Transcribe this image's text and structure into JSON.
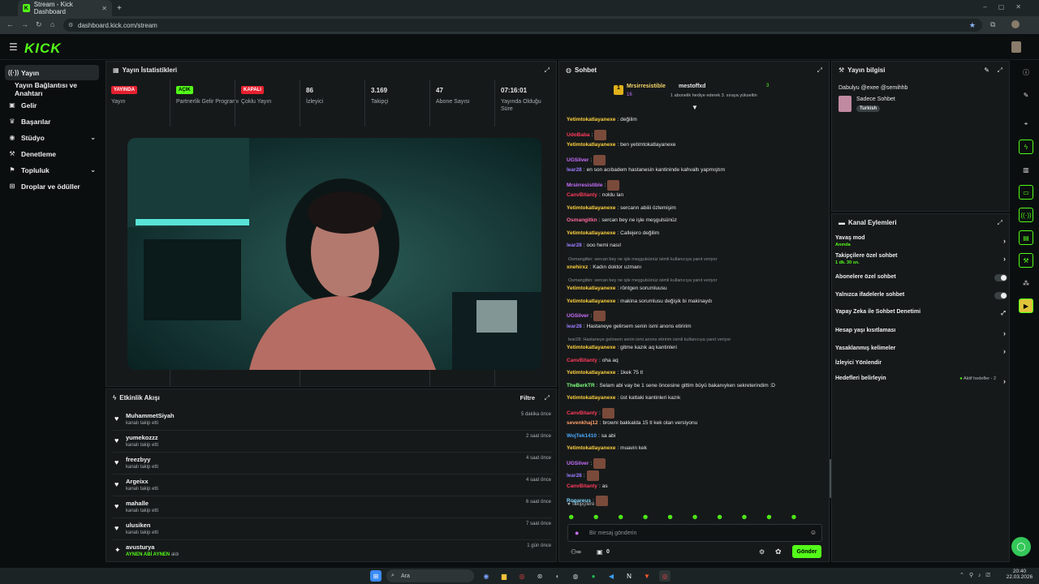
{
  "browser": {
    "tab_title": "Stream - Kick Dashboard",
    "url": "dashboard.kick.com/stream"
  },
  "app": {
    "logo": "KICK"
  },
  "sidebar": {
    "items": [
      {
        "label": "Yayın",
        "icon": "broadcast-icon"
      },
      {
        "label": "Yayın Bağlantısı ve Anahtarı",
        "icon": ""
      },
      {
        "label": "Gelir",
        "icon": "money-icon"
      },
      {
        "label": "Başarılar",
        "icon": "trophy-icon"
      },
      {
        "label": "Stüdyo",
        "icon": "palette-icon"
      },
      {
        "label": "Denetleme",
        "icon": "wrench-icon"
      },
      {
        "label": "Topluluk",
        "icon": "community-icon"
      },
      {
        "label": "Droplar ve ödüller",
        "icon": "gift-icon"
      }
    ]
  },
  "stats": {
    "title": "Yayın İstatistikleri",
    "items": [
      {
        "value": "YAYINDA",
        "label": "Yayın",
        "badge_color": "#e5202f"
      },
      {
        "value": "AÇIK",
        "label": "Partnerlik Gelir Programı",
        "badge_color": "#53fc18"
      },
      {
        "value": "KAPALI",
        "label": "Çoklu Yayın",
        "badge_color": "#e5202f"
      },
      {
        "value": "86",
        "label": "İzleyici"
      },
      {
        "value": "3.169",
        "label": "Takipçi"
      },
      {
        "value": "47",
        "label": "Abone Sayısı"
      },
      {
        "value": "07:16:01",
        "label": "Yayında Olduğu Süre"
      }
    ]
  },
  "activity": {
    "title": "Etkinlik Akışı",
    "filter": "Filtre",
    "items": [
      {
        "name": "MuhammetSiyah",
        "sub": "kanalı takip etti",
        "time": "5 dakika önce"
      },
      {
        "name": "yumekozzz",
        "sub": "kanalı takip etti",
        "time": "2 saat önce"
      },
      {
        "name": "freezbyy",
        "sub": "kanalı takip etti",
        "time": "4 saat önce"
      },
      {
        "name": "Argeixx",
        "sub": "kanalı takip etti",
        "time": "4 saat önce"
      },
      {
        "name": "mahalle",
        "sub": "kanalı takip etti",
        "time": "6 saat önce"
      },
      {
        "name": "ulusiken",
        "sub": "kanalı takip etti",
        "time": "7 saat önce"
      },
      {
        "name": "avusturya",
        "sub": "AYNEN ABİ AYNEN",
        "sub2": "aldı",
        "time": "1 gün önce"
      }
    ]
  },
  "chat": {
    "title": "Sohbet",
    "pinned": {
      "user1": "Mrsirresistible",
      "count1": "16",
      "user2": "mestoffxd",
      "count2": "3",
      "note": "1 abonelik hediye ederek 3. sıraya yükseltin"
    },
    "lines": [
      {
        "user": "Yetimtokatlayanexe",
        "color": "#ffd23f",
        "text": "değilim"
      },
      {
        "user": "UdoBaba",
        "color": "#ff3b5c",
        "text": "",
        "emote": true
      },
      {
        "user": "Yetimtokatlayanexe",
        "color": "#ffd23f",
        "text": "ben yetimtokatlayanexe"
      },
      {
        "user": "UGSilver",
        "color": "#c870ff",
        "text": "",
        "emote": true
      },
      {
        "user": "lear28",
        "color": "#9b7cff",
        "text": "en son acıbadem hastanesin kantininde kahvaltı yapmıştım"
      },
      {
        "user": "Mrsirresistible",
        "color": "#c870ff",
        "text": "",
        "emote": true
      },
      {
        "user": "CanvBitanty",
        "color": "#ff3b5c",
        "text": "noldu lan"
      },
      {
        "user": "Yetimtokatlayanexe",
        "color": "#ffd23f",
        "text": "sercann abiiii özlemişim"
      },
      {
        "user": "Osmangitkn",
        "color": "#ff6a9a",
        "text": "sercan bey ne işle meşgulsünüz"
      },
      {
        "user": "Yetimtokatlayanexe",
        "color": "#ffd23f",
        "text": "Callejero değilim"
      },
      {
        "user": "lear28",
        "color": "#9b7cff",
        "text": "ooo hemi nasıl"
      },
      {
        "reply": "Osmangitkn: sercan bey ne işle meşgulsünüz isimli kullanıcıya yanıt veriyor"
      },
      {
        "user": "xnehirxz",
        "color": "#ffd23f",
        "text": "Kadın doktor uzmanı"
      },
      {
        "reply": "Osmangitkn: sercan bey ne işle meşgulsünüz isimli kullanıcıya yanıt veriyor"
      },
      {
        "user": "Yetimtokatlayanexe",
        "color": "#ffd23f",
        "text": "röntgen sorumluusu"
      },
      {
        "user": "Yetimtokatlayanexe",
        "color": "#ffd23f",
        "text": "makina sorumlusu değişik bi makinaydı"
      },
      {
        "user": "UGSilver",
        "color": "#c870ff",
        "text": "",
        "emote": true
      },
      {
        "user": "lear28",
        "color": "#9b7cff",
        "text": "Hastaneye gelirsem senin ismi anons etiririm"
      },
      {
        "reply": "lear28: Hastaneye gelirsem senin ismi anons etiririm isimli kullanıcıya yanıt veriyor"
      },
      {
        "user": "Yetimtokatlayanexe",
        "color": "#ffd23f",
        "text": "gitme kazık aq kantinleri"
      },
      {
        "user": "CanvBitanty",
        "color": "#ff3b5c",
        "text": "oha aq"
      },
      {
        "user": "Yetimtokatlayanexe",
        "color": "#ffd23f",
        "text": "1kek 75 tl"
      },
      {
        "user": "TheBerkTR",
        "color": "#7dff7d",
        "text": "Selam abi vay be 1 sene öncesine gittim büyü bakanıyken sekreterindim :D"
      },
      {
        "user": "Yetimtokatlayanexe",
        "color": "#ffd23f",
        "text": "üst kattaki kantinleri kazık"
      },
      {
        "user": "CanvBitanty",
        "color": "#ff3b5c",
        "text": "",
        "emote": true
      },
      {
        "user": "sevenkhaj12",
        "color": "#ff9f6a",
        "text": "browni bakkalda 15 tl kek olan versiyonu"
      },
      {
        "user": "WojTek1410",
        "color": "#4aa8ff",
        "text": "sa abi"
      },
      {
        "user": "Yetimtokatlayanexe",
        "color": "#ffd23f",
        "text": "muavin kek"
      },
      {
        "user": "UGSilver",
        "color": "#c870ff",
        "text": "",
        "emote": true
      },
      {
        "user": "lear28",
        "color": "#9b7cff",
        "text": "",
        "emote": true
      },
      {
        "user": "CanvBitanty",
        "color": "#ff3b5c",
        "text": "as"
      },
      {
        "user": "Rogareus",
        "color": "#7fd6ff",
        "text": "",
        "emote": true
      }
    ],
    "followers_only": "Takipçilere Özel",
    "input_placeholder": "Bir mesaj gönderin",
    "points": "0",
    "send": "Gönder"
  },
  "stream_info": {
    "title": "Yayın bilgisi",
    "stream_title": "Dabulyu @exee @semihhb",
    "category": "Sadece Sohbet",
    "tag": "Turkish"
  },
  "channel_actions": {
    "title": "Kanal Eylemleri",
    "items": [
      {
        "label": "Yavaş mod",
        "sub": "Anında",
        "kind": "arrow"
      },
      {
        "label": "Takipçilere özel sohbet",
        "sub": "1 dk. 30 sn.",
        "kind": "arrow"
      },
      {
        "label": "Abonelere özel sohbet",
        "sub": "",
        "kind": "toggle"
      },
      {
        "label": "Yalnızca ifadelerle sohbet",
        "sub": "",
        "kind": "toggle"
      },
      {
        "label": "Yapay Zeka ile Sohbet Denetimi",
        "sub": "",
        "kind": "external"
      },
      {
        "label": "Hesap yaşı kısıtlaması",
        "sub": "",
        "kind": "arrow"
      },
      {
        "label": "Yasaklanmış kelimeler",
        "sub": "",
        "kind": "arrow"
      },
      {
        "label": "İzleyici Yönlendir",
        "sub": "",
        "kind": "none"
      },
      {
        "label": "Hedefleri belirleyin",
        "sub": "",
        "kind": "goal",
        "extra": "Aktif hedefler - 2"
      }
    ]
  },
  "taskbar": {
    "search": "Ara",
    "time": "20:40",
    "date": "22.03.2026"
  }
}
